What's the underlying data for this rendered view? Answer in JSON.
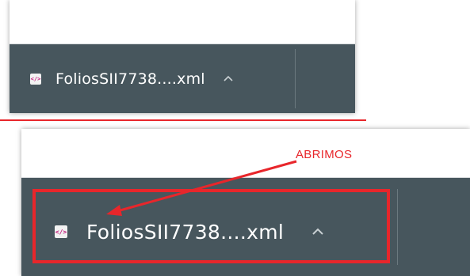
{
  "downloads_bar_top": {
    "file_name": "FoliosSII7738....xml",
    "file_icon": "xml-file-icon",
    "expand_icon": "chevron-up-icon"
  },
  "downloads_bar_bottom": {
    "file_name": "FoliosSII7738....xml",
    "file_icon": "xml-file-icon",
    "expand_icon": "chevron-up-icon"
  },
  "annotation": {
    "label": "ABRIMOS",
    "color": "#e8262b"
  },
  "colors": {
    "bar_background": "#47565d",
    "text": "#ffffff",
    "annotation": "#e8262b"
  }
}
